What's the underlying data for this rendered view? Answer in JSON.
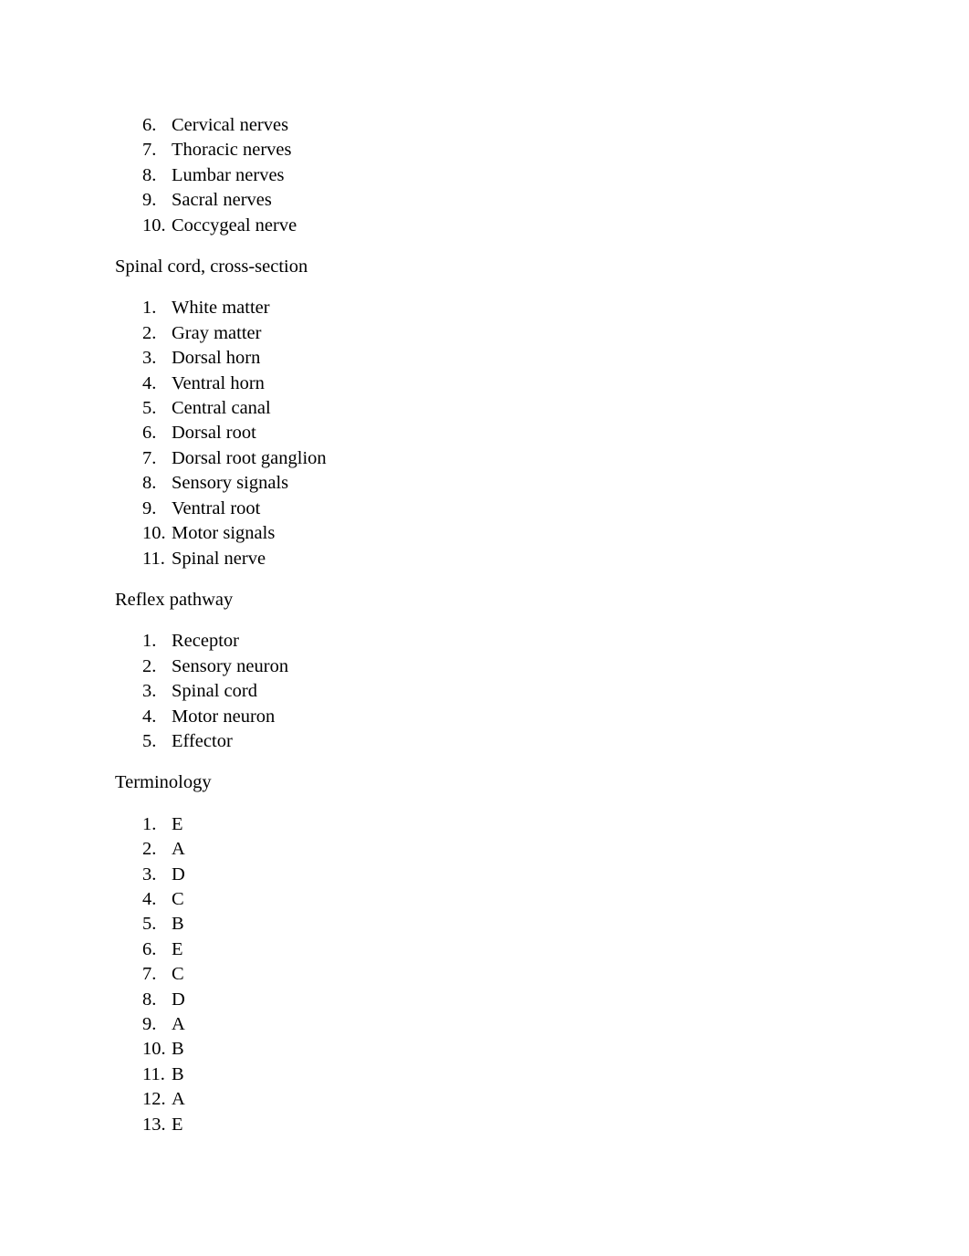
{
  "page": {
    "background_color": "#ffffff",
    "text_color": "#000000"
  },
  "blocks": {
    "spinal_nerves_continued": {
      "items": [
        {
          "marker": "6.",
          "text": "Cervical nerves"
        },
        {
          "marker": "7.",
          "text": "Thoracic nerves"
        },
        {
          "marker": "8.",
          "text": "Lumbar nerves"
        },
        {
          "marker": "9.",
          "text": "Sacral nerves"
        },
        {
          "marker": "10.",
          "text": "Coccygeal nerve"
        }
      ]
    },
    "spinal_cord_cross_section": {
      "heading": "Spinal cord, cross-section",
      "items": [
        {
          "marker": "1.",
          "text": "White matter"
        },
        {
          "marker": "2.",
          "text": "Gray matter"
        },
        {
          "marker": "3.",
          "text": "Dorsal horn"
        },
        {
          "marker": "4.",
          "text": "Ventral horn"
        },
        {
          "marker": "5.",
          "text": "Central canal"
        },
        {
          "marker": "6.",
          "text": "Dorsal root"
        },
        {
          "marker": "7.",
          "text": "Dorsal root ganglion"
        },
        {
          "marker": "8.",
          "text": "Sensory signals"
        },
        {
          "marker": "9.",
          "text": "Ventral root"
        },
        {
          "marker": "10.",
          "text": "Motor signals"
        },
        {
          "marker": "11.",
          "text": "Spinal nerve"
        }
      ]
    },
    "reflex_pathway": {
      "heading": "Reflex pathway",
      "items": [
        {
          "marker": "1.",
          "text": "Receptor"
        },
        {
          "marker": "2.",
          "text": "Sensory neuron"
        },
        {
          "marker": "3.",
          "text": "Spinal cord"
        },
        {
          "marker": "4.",
          "text": "Motor neuron"
        },
        {
          "marker": "5.",
          "text": "Effector"
        }
      ]
    },
    "terminology": {
      "heading": "Terminology",
      "items": [
        {
          "marker": "1.",
          "text": "E"
        },
        {
          "marker": "2.",
          "text": "A"
        },
        {
          "marker": "3.",
          "text": "D"
        },
        {
          "marker": "4.",
          "text": "C"
        },
        {
          "marker": "5.",
          "text": "B"
        },
        {
          "marker": "6.",
          "text": "E"
        },
        {
          "marker": "7.",
          "text": "C"
        },
        {
          "marker": "8.",
          "text": "D"
        },
        {
          "marker": "9.",
          "text": "A"
        },
        {
          "marker": "10.",
          "text": "B"
        },
        {
          "marker": "11.",
          "text": "B"
        },
        {
          "marker": "12.",
          "text": "A"
        },
        {
          "marker": "13.",
          "text": "E"
        }
      ]
    }
  }
}
